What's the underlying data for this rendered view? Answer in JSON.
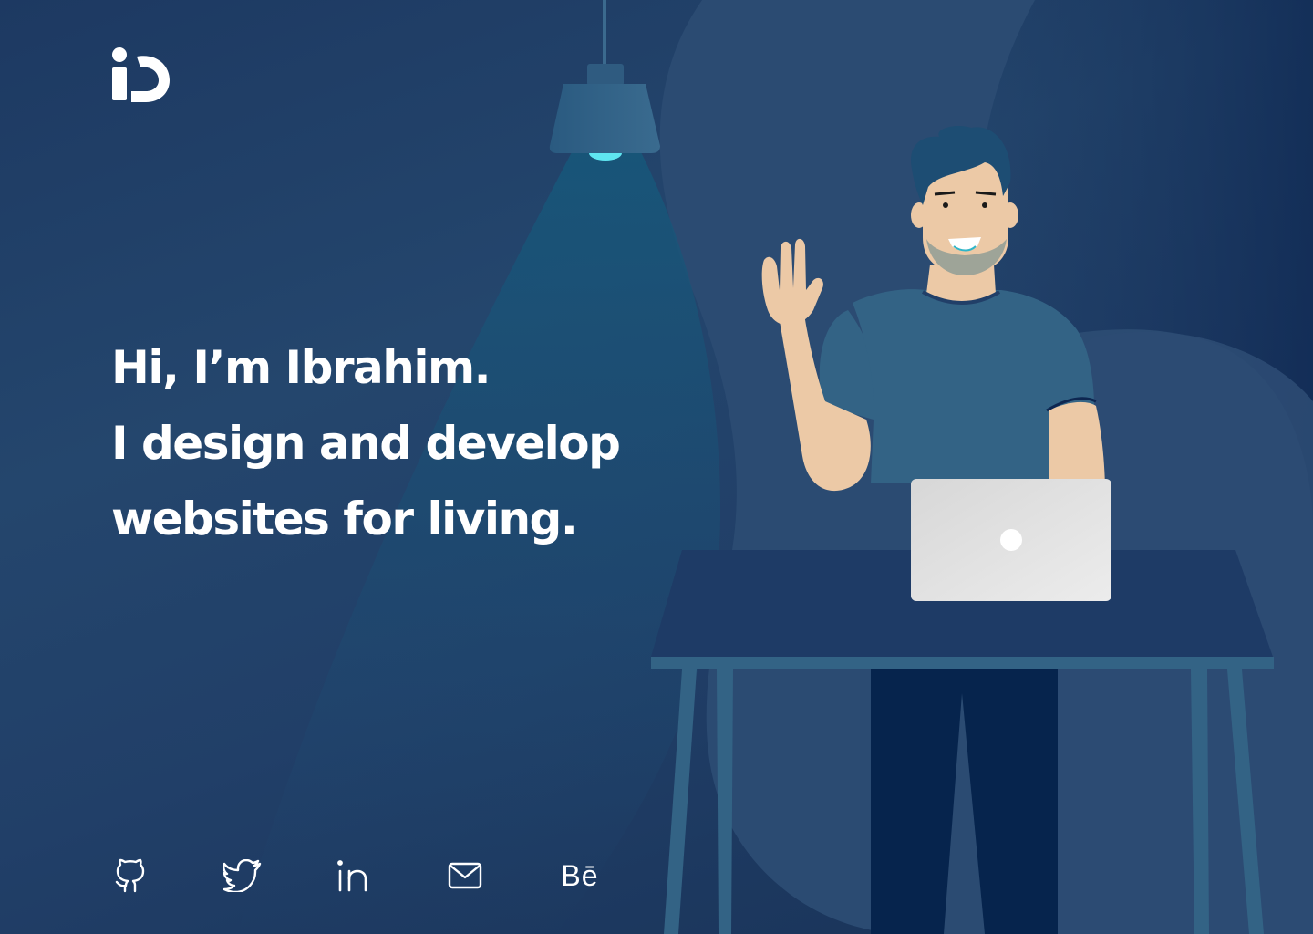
{
  "brand": {
    "logo_icon": "ib-logo-icon"
  },
  "hero": {
    "line1": "Hi, I’m Ibrahim.",
    "line2": "I design and develop",
    "line3": "websites for living."
  },
  "social": {
    "behance_label": "Bē",
    "icons": [
      "github-icon",
      "twitter-icon",
      "linkedin-icon",
      "mail-icon",
      "behance-icon"
    ]
  },
  "colors": {
    "background": "#213f68",
    "blob": "#2a4a71",
    "shirt": "#336385",
    "table": "#1d3a63",
    "skin": "#ecc9a6",
    "laptop": "#d5d5d5",
    "lamp_light": "#5fe5f0",
    "text": "#ffffff"
  }
}
